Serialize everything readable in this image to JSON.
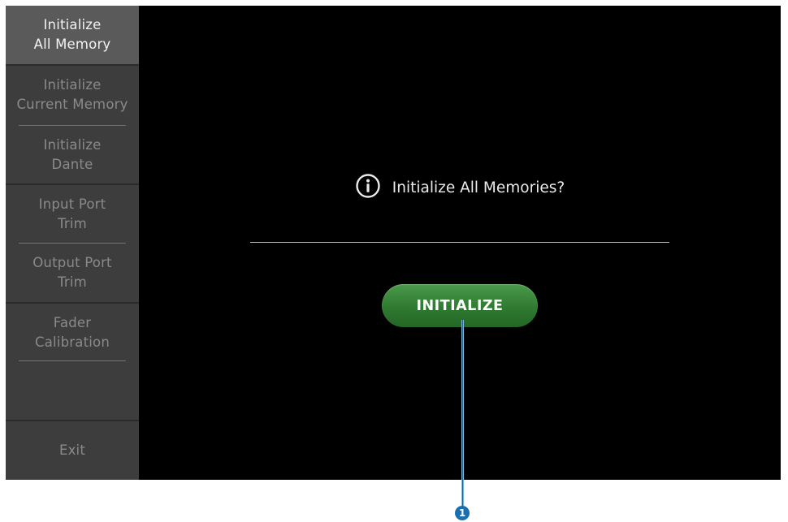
{
  "sidebar": {
    "items": [
      {
        "label_line1": "Initialize",
        "label_line2": "All Memory",
        "active": true
      },
      {
        "label_line1": "Initialize",
        "label_line2": "Current Memory",
        "active": false
      },
      {
        "label_line1": "Initialize",
        "label_line2": "Dante",
        "active": false
      },
      {
        "label_line1": "Input Port",
        "label_line2": "Trim",
        "active": false
      },
      {
        "label_line1": "Output Port",
        "label_line2": "Trim",
        "active": false
      },
      {
        "label_line1": "Fader",
        "label_line2": "Calibration",
        "active": false
      }
    ],
    "exit_label": "Exit"
  },
  "main": {
    "info_icon": "info-icon",
    "message": "Initialize All Memories?",
    "initialize_button_label": "INITIALIZE"
  },
  "callout": {
    "number": "1",
    "color": "#1a6fae"
  },
  "colors": {
    "button_green": "#2f7a31",
    "screen_background": "#000000",
    "sidebar_background": "#3d3d3d",
    "sidebar_active": "#5a5a5a"
  }
}
